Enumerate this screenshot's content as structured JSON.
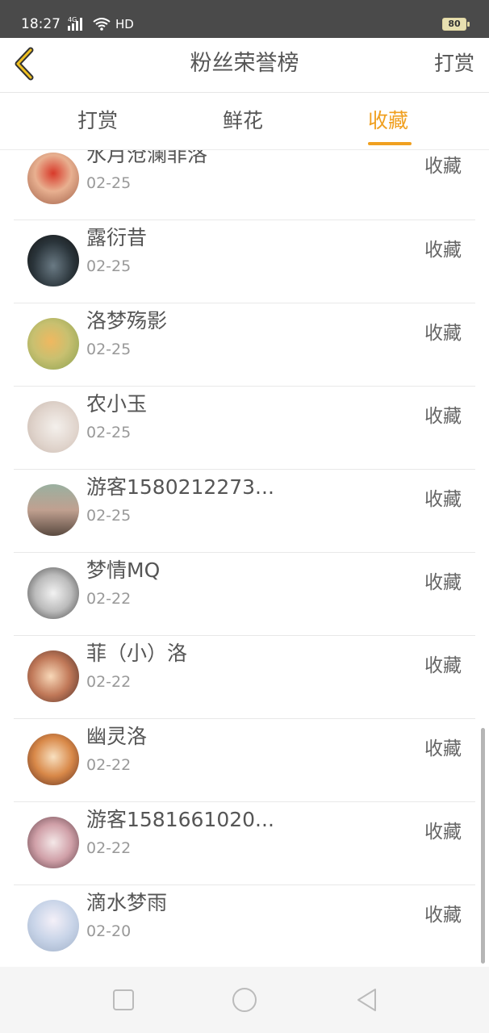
{
  "status_bar": {
    "time": "18:27",
    "network": "4G",
    "quality": "HD",
    "battery": "80"
  },
  "navbar": {
    "title": "粉丝荣誉榜",
    "right_action": "打赏",
    "back_icon": "chevron-left-icon"
  },
  "tabs": [
    {
      "label": "打赏",
      "active": false
    },
    {
      "label": "鲜花",
      "active": false
    },
    {
      "label": "收藏",
      "active": true
    }
  ],
  "colors": {
    "accent": "#f0a020",
    "text": "#555555",
    "muted": "#999999"
  },
  "fans": [
    {
      "name": "水月沧澜菲洛",
      "date": "02-25",
      "action": "收藏"
    },
    {
      "name": "露衍昔",
      "date": "02-25",
      "action": "收藏"
    },
    {
      "name": "洛梦殇影",
      "date": "02-25",
      "action": "收藏"
    },
    {
      "name": "农小玉",
      "date": "02-25",
      "action": "收藏"
    },
    {
      "name": "游客1580212273...",
      "date": "02-25",
      "action": "收藏"
    },
    {
      "name": "梦情MQ",
      "date": "02-22",
      "action": "收藏"
    },
    {
      "name": "菲（小）洛",
      "date": "02-22",
      "action": "收藏"
    },
    {
      "name": "幽灵洛",
      "date": "02-22",
      "action": "收藏"
    },
    {
      "name": "游客1581661020...",
      "date": "02-22",
      "action": "收藏"
    },
    {
      "name": "滴水梦雨",
      "date": "02-20",
      "action": "收藏"
    }
  ],
  "system_nav": [
    "square-icon",
    "circle-icon",
    "triangle-back-icon"
  ]
}
